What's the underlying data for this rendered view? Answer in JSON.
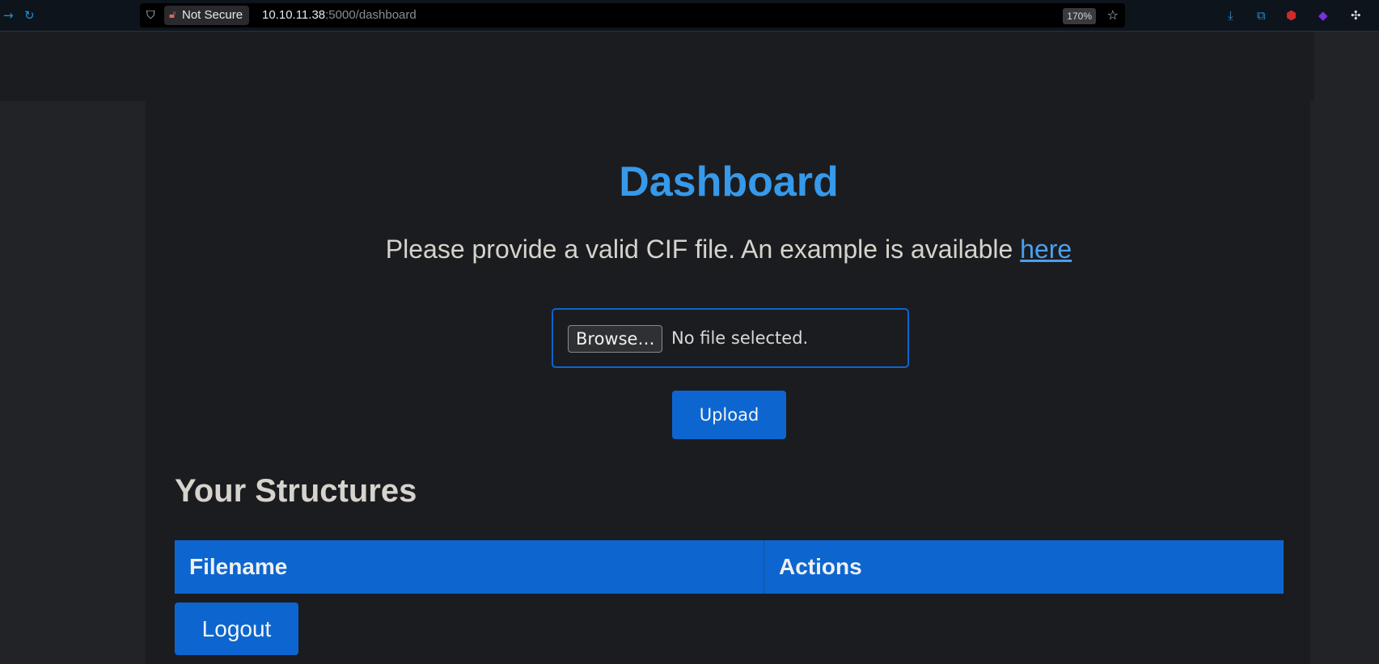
{
  "browser": {
    "security_label": "Not Secure",
    "url_host": "10.10.11.38",
    "url_path": ":5000/dashboard",
    "zoom": "170%"
  },
  "page": {
    "title": "Dashboard",
    "instruction": "Please provide a valid CIF file. An example is available",
    "example_link": "here",
    "browse_label": "Browse…",
    "file_status": "No file selected.",
    "upload_label": "Upload",
    "structures_heading": "Your Structures",
    "table": {
      "columns": [
        "Filename",
        "Actions"
      ]
    },
    "logout_label": "Logout"
  },
  "colors": {
    "accent": "#0d66d0",
    "title": "#3699ea",
    "background": "#1b1c1f"
  }
}
